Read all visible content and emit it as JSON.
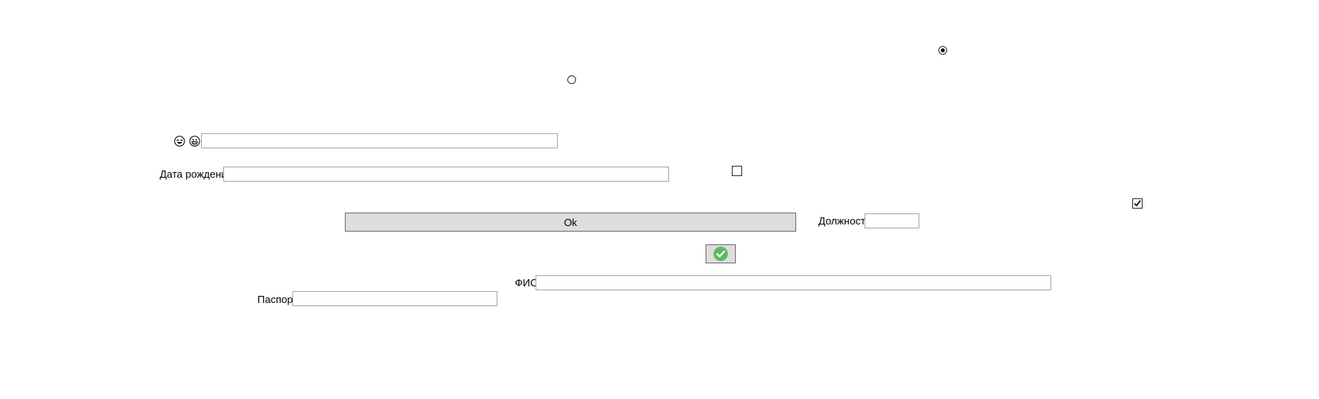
{
  "form": {
    "ok_button_label": "Ok",
    "birth_date_label": "Дата рождения",
    "birth_date_value": "",
    "position_label": "Должность",
    "position_value": "",
    "fio_label": "ФИО",
    "fio_value": "",
    "passport_label": "Паспорт",
    "passport_value": "",
    "emoji_field_value": ""
  },
  "controls": {
    "radio_top_selected": true,
    "radio_middle_selected": false,
    "checkbox_middle_checked": false,
    "checkbox_right_checked": true
  },
  "icons": {
    "emoji_1": "laughing-face-icon",
    "emoji_2": "grinning-face-icon",
    "confirm_button_icon": "green-check-circle-icon"
  },
  "colors": {
    "button_bg": "#dddddd",
    "border": "#a9a9a9",
    "check_green": "#5cb85c"
  }
}
